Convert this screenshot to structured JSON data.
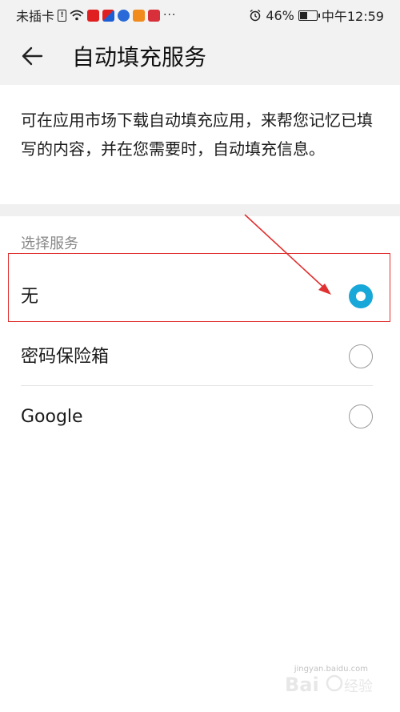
{
  "status_bar": {
    "carrier": "未插卡",
    "sim_label": "!",
    "battery_percent": "46%",
    "time": "中午12:59",
    "dots": "···"
  },
  "app_bar": {
    "title": "自动填充服务"
  },
  "description": "可在应用市场下载自动填充应用，来帮您记忆已填写的内容，并在您需要时，自动填充信息。",
  "section": {
    "header": "选择服务",
    "options": [
      {
        "label": "无",
        "selected": true
      },
      {
        "label": "密码保险箱",
        "selected": false
      },
      {
        "label": "Google",
        "selected": false
      }
    ]
  },
  "colors": {
    "accent": "#17a7d8",
    "annotation": "#e03030",
    "app_bar_bg": "#f2f2f2"
  },
  "watermark": {
    "sub": "jingyan.baidu.com"
  }
}
